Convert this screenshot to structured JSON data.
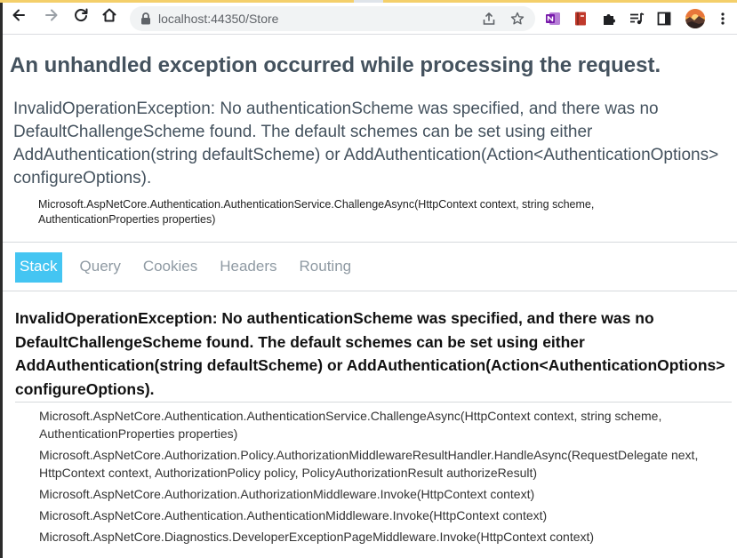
{
  "browser": {
    "url": "localhost:44350/Store"
  },
  "page": {
    "title": "An unhandled exception occurred while processing the request.",
    "error_message": "InvalidOperationException: No authenticationScheme was specified, and there was no DefaultChallengeScheme found. The default schemes can be set using either AddAuthentication(string defaultScheme) or AddAuthentication(Action<AuthenticationOptions> configureOptions).",
    "error_location": "Microsoft.AspNetCore.Authentication.AuthenticationService.ChallengeAsync(HttpContext context, string scheme, AuthenticationProperties properties)",
    "tabs": [
      {
        "label": "Stack"
      },
      {
        "label": "Query"
      },
      {
        "label": "Cookies"
      },
      {
        "label": "Headers"
      },
      {
        "label": "Routing"
      }
    ],
    "stack_heading": "InvalidOperationException: No authenticationScheme was specified, and there was no DefaultChallengeScheme found. The default schemes can be set using either AddAuthentication(string defaultScheme) or AddAuthentication(Action<AuthenticationOptions> configureOptions).",
    "frames": [
      "Microsoft.AspNetCore.Authentication.AuthenticationService.ChallengeAsync(HttpContext context, string scheme, AuthenticationProperties properties)",
      "Microsoft.AspNetCore.Authorization.Policy.AuthorizationMiddlewareResultHandler.HandleAsync(RequestDelegate next, HttpContext context, AuthorizationPolicy policy, PolicyAuthorizationResult authorizeResult)",
      "Microsoft.AspNetCore.Authorization.AuthorizationMiddleware.Invoke(HttpContext context)",
      "Microsoft.AspNetCore.Authentication.AuthenticationMiddleware.Invoke(HttpContext context)",
      "Microsoft.AspNetCore.Diagnostics.DeveloperExceptionPageMiddleware.Invoke(HttpContext context)"
    ]
  },
  "colors": {
    "title": "#44525e",
    "active_tab": "#44c5f2",
    "inactive_tab": "#8f9aa3"
  },
  "icons": {
    "back": "arrow-left-icon",
    "forward": "arrow-right-icon",
    "reload": "reload-icon",
    "home": "home-icon",
    "site_info": "lock-icon",
    "share": "share-icon",
    "bookmark": "star-icon",
    "extensions": [
      "onenote-icon",
      "book-icon",
      "puzzle-icon",
      "media-queue-icon",
      "side-panel-icon",
      "avatar"
    ]
  }
}
